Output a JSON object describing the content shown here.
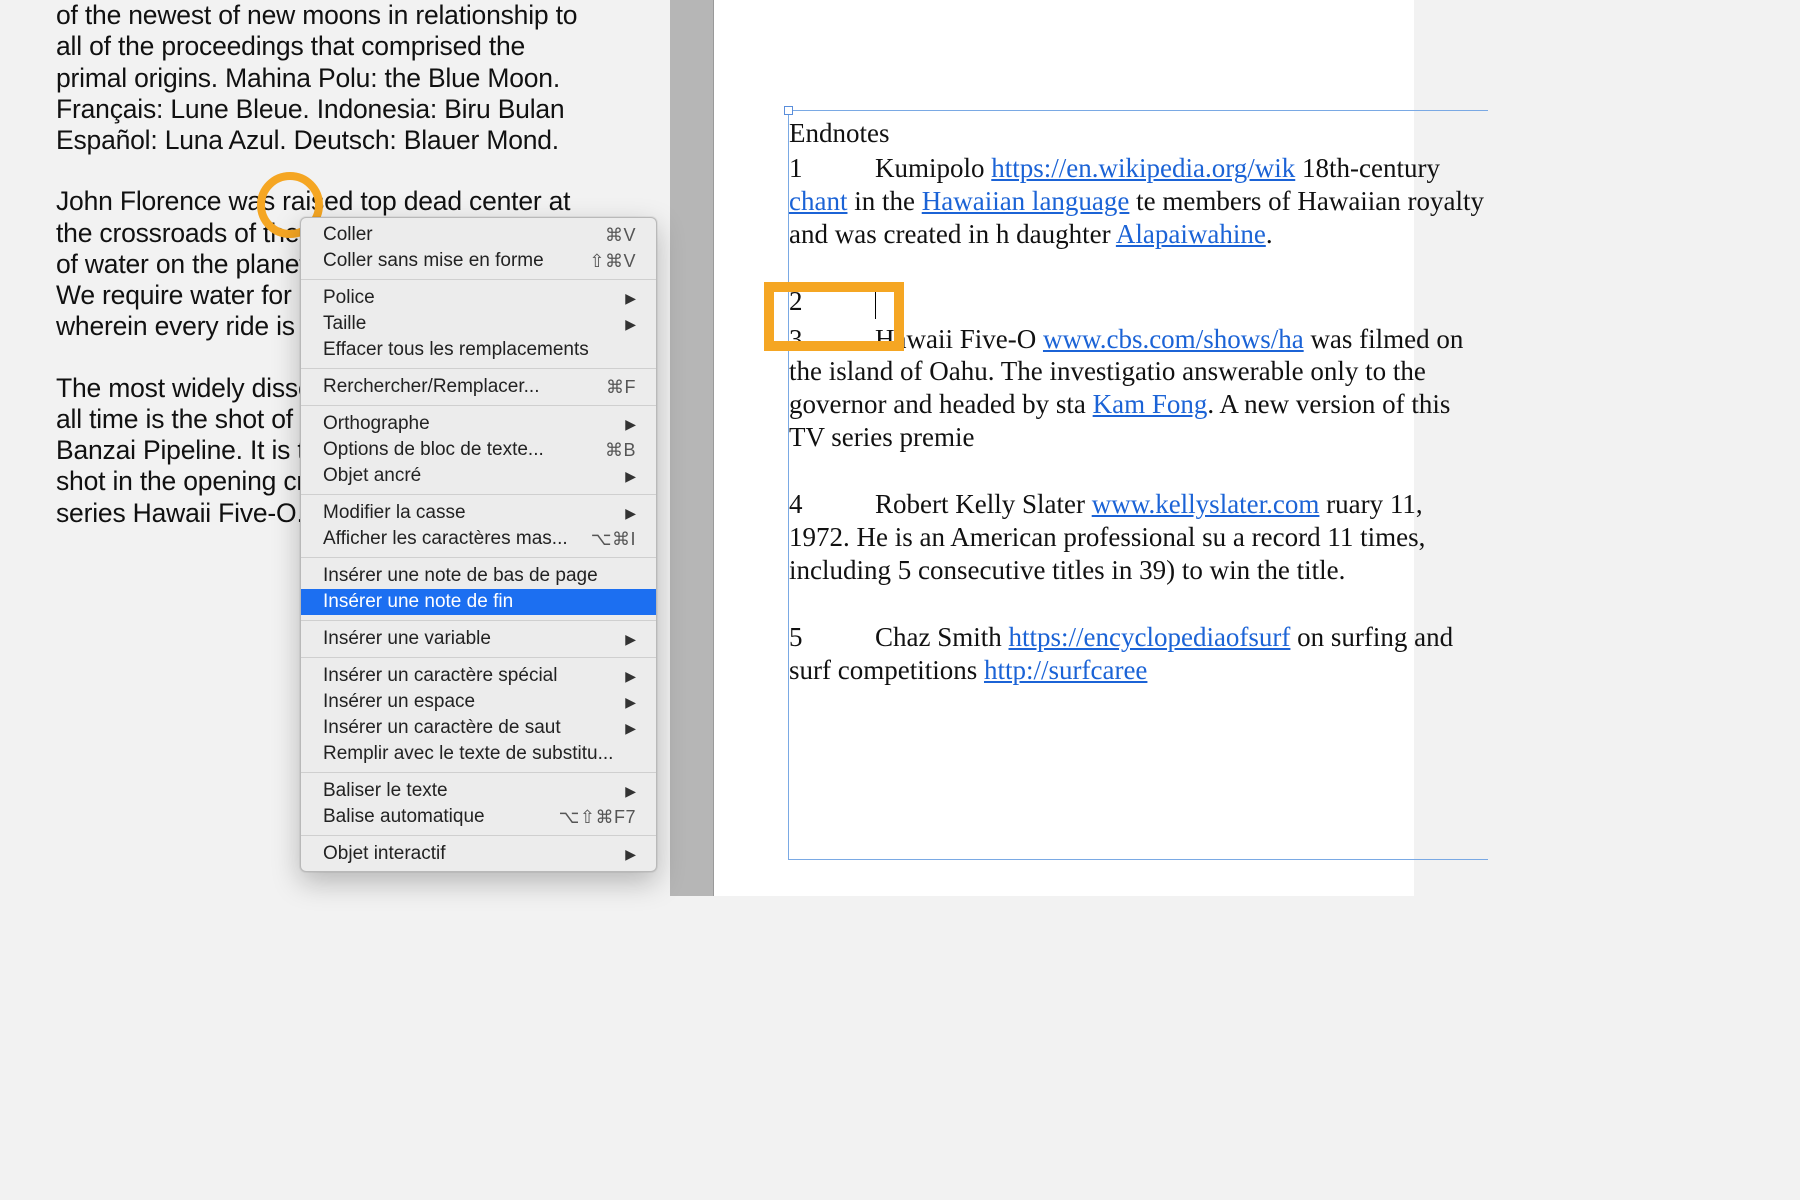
{
  "story": {
    "p1": "of the newest of new moons in relationship to all of the proceedings that comprised the primal origins. Mahina Polu: the Blue Moon. Français: Lune Bleue. Indonesia: Biru Bulan Español: Luna Azul. Deutsch: Blauer Mond.",
    "p2": "John Florence was raised top dead center at the crossroads of the Pacific, the largest body of water on the planet. Take note: it is water. We require water for life — not surfing, wherein every ride is a walk on water.",
    "p3": "The most widely disseminated surfing clip of all time is the shot of a wave breaking at the Banzai Pipeline. It is the single most dominant shot in the opening credits of the television series Hawaii Five-O."
  },
  "endnotes": {
    "title": "Endnotes",
    "items": [
      {
        "num": "1",
        "text_a": "Kumipolo ",
        "link1_text": "https://en.wikipedia.org/wik",
        "text_b": " 18th-century ",
        "link2_text": "chant",
        "text_c": " in the ",
        "link3_text": "Hawaiian language",
        "text_d": " te members of Hawaiian royalty and was created in h daughter ",
        "link4_text": "Alapaiwahine",
        "text_e": "."
      },
      {
        "num": "2",
        "text_a": ""
      },
      {
        "num": "3",
        "text_a": "Hawaii Five-O ",
        "link1_text": "www.cbs.com/shows/ha",
        "text_b": " was filmed on the island of Oahu. The investigatio answerable only to the governor and headed by sta ",
        "link2_text": "Kam Fong",
        "text_c": ". A new version of this TV series premie"
      },
      {
        "num": "4",
        "text_a": "Robert Kelly Slater ",
        "link1_text": "www.kellyslater.com",
        "text_b": " ruary 11, 1972. He is an American professional su a record 11 times, including 5 consecutive titles in 39) to win the title."
      },
      {
        "num": "5",
        "text_a": "Chaz Smith ",
        "link1_text": "https://encyclopediaofsurf",
        "text_b": " on surfing and surf competitions ",
        "link2_text": "http://surfcaree"
      }
    ]
  },
  "menu": {
    "groups": [
      [
        {
          "label": "Coller",
          "shortcut": "⌘V",
          "submenu": false
        },
        {
          "label": "Coller sans mise en forme",
          "shortcut": "⇧⌘V",
          "submenu": false
        }
      ],
      [
        {
          "label": "Police",
          "submenu": true
        },
        {
          "label": "Taille",
          "submenu": true
        },
        {
          "label": "Effacer tous les remplacements",
          "submenu": false
        }
      ],
      [
        {
          "label": "Rerchercher/Remplacer...",
          "shortcut": "⌘F",
          "submenu": false
        }
      ],
      [
        {
          "label": "Orthographe",
          "submenu": true
        },
        {
          "label": "Options de bloc de texte...",
          "shortcut": "⌘B",
          "submenu": false
        },
        {
          "label": "Objet ancré",
          "submenu": true
        }
      ],
      [
        {
          "label": "Modifier la casse",
          "submenu": true
        },
        {
          "label": "Afficher les caractères mas...",
          "shortcut": "⌥⌘I",
          "submenu": false
        }
      ],
      [
        {
          "label": "Insérer une note de bas de page",
          "submenu": false
        },
        {
          "label": "Insérer une note de fin",
          "submenu": false,
          "highlight": true
        }
      ],
      [
        {
          "label": "Insérer une variable",
          "submenu": true
        }
      ],
      [
        {
          "label": "Insérer un caractère spécial",
          "submenu": true
        },
        {
          "label": "Insérer un espace",
          "submenu": true
        },
        {
          "label": "Insérer un caractère de saut",
          "submenu": true
        },
        {
          "label": "Remplir avec le texte de substitu...",
          "submenu": false
        }
      ],
      [
        {
          "label": "Baliser le texte",
          "submenu": true
        },
        {
          "label": "Balise automatique",
          "shortcut": "⌥⇧⌘F7",
          "submenu": false
        }
      ],
      [
        {
          "label": "Objet interactif",
          "submenu": true
        }
      ]
    ]
  }
}
